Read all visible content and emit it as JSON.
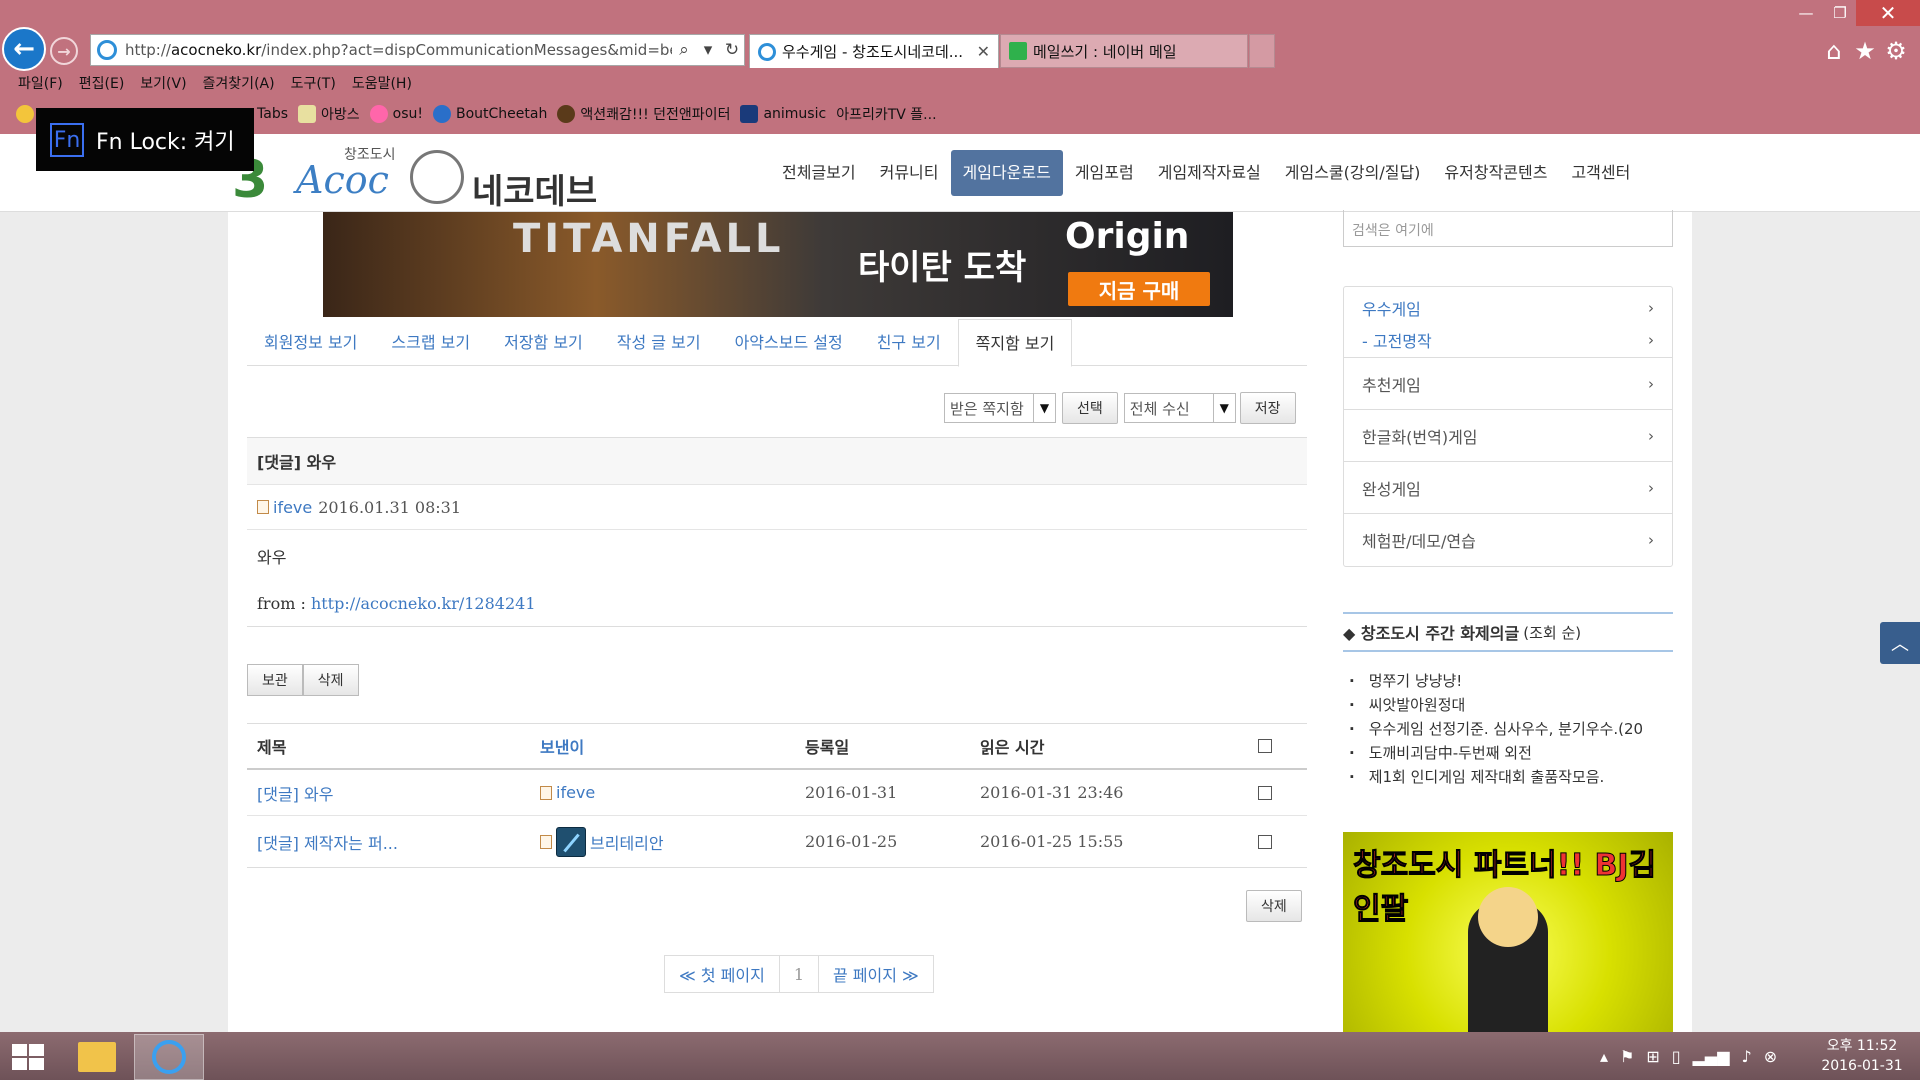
{
  "browser": {
    "url_prefix": "http://",
    "url_domain": "acocneko.kr",
    "url_rest": "/index.php?act=dispCommunicationMessages&mid=bestgam",
    "tabs": [
      {
        "label": "우수게임 - 창조도시네코데...",
        "active": true,
        "icon": "ie-icon"
      },
      {
        "label": "메일쓰기 : 네이버 메일",
        "active": false,
        "icon": "mail-icon"
      }
    ],
    "menu": [
      "파일(F)",
      "편집(E)",
      "보기(V)",
      "즐겨찾기(A)",
      "도구(T)",
      "도움말(H)"
    ],
    "favorites": [
      "Tabs",
      "아방스",
      "osu!",
      "BoutCheetah",
      "액션쾌감!!! 던전앤파이터",
      "animusic",
      "아프리카TV 플..."
    ],
    "fn_lock": "Fn Lock: 켜기",
    "fn_label": "Fn"
  },
  "site": {
    "logo_small": "창조도시",
    "logo_main": "Acoc",
    "logo_name": "네코데브",
    "nav": [
      "전체글보기",
      "커뮤니티",
      "게임다운로드",
      "게임포럼",
      "게임제작자료실",
      "게임스쿨(강의/질답)",
      "유저창작콘텐츠",
      "고객센터"
    ],
    "nav_active": 2
  },
  "banner": {
    "title": "TITANFALL",
    "text": "타이탄 도착",
    "brand": "Origin",
    "button": "지금 구매"
  },
  "tabs": [
    "회원정보 보기",
    "스크랩 보기",
    "저장함 보기",
    "작성 글 보기",
    "아약스보드 설정",
    "친구 보기",
    "쪽지함 보기"
  ],
  "tabs_active": 6,
  "controls": {
    "box_select": "받은 쪽지함",
    "select_button": "선택",
    "filter_select": "전체 수신",
    "save_button": "저장"
  },
  "message": {
    "title": "[댓글] 와우",
    "sender": "ifeve",
    "datetime": "2016.01.31 08:31",
    "body": "와우",
    "from_label": "from : ",
    "from_link": "http://acocneko.kr/1284241"
  },
  "actions": {
    "keep": "보관",
    "delete": "삭제"
  },
  "list": {
    "headers": {
      "title": "제목",
      "sender": "보낸이",
      "date": "등록일",
      "read": "읽은 시간"
    },
    "rows": [
      {
        "title": "[댓글] 와우",
        "sender": "ifeve",
        "date": "2016-01-31",
        "read": "2016-01-31 23:46"
      },
      {
        "title": "[댓글] 제작자는 퍼...",
        "sender": "브리테리안",
        "date": "2016-01-25",
        "read": "2016-01-25 15:55"
      }
    ],
    "delete": "삭제"
  },
  "pager": {
    "first": "≪ 첫 페이지",
    "page": "1",
    "last": "끝 페이지 ≫"
  },
  "sidebar": {
    "search_placeholder": "검색은 여기에",
    "menu": [
      {
        "label": "우수게임"
      },
      {
        "label": "- 고전명작"
      },
      {
        "label": "추천게임"
      },
      {
        "label": "한글화(번역)게임"
      },
      {
        "label": "완성게임"
      },
      {
        "label": "체험판/데모/연습"
      }
    ],
    "weekly_title": "◆ 창조도시 주간 화제의글",
    "weekly_sub": "(조회 순)",
    "weekly_items": [
      "멍쭈기 냥냥냥!",
      "씨앗발아원정대",
      "우수게임 선정기준. 심사우수, 분기우수.(20",
      "도깨비괴담中-두번째 외전",
      "제1회 인디게임 제작대회 출품작모음."
    ],
    "bj_banner": "창조도시 파트너!! BJ김인팔"
  },
  "taskbar": {
    "time": "오후 11:52",
    "date": "2016-01-31"
  }
}
